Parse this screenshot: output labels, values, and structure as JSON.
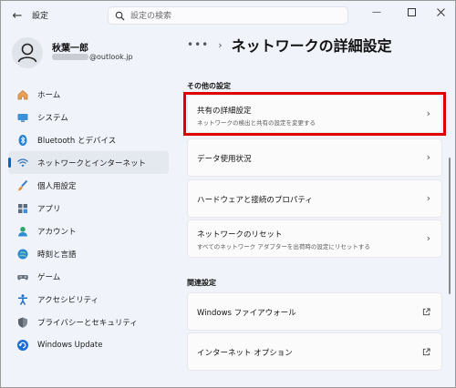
{
  "app": {
    "title": "設定"
  },
  "search": {
    "placeholder": "設定の検索"
  },
  "profile": {
    "name": "秋葉一郎",
    "email_suffix": "@outlook.jp"
  },
  "sidebar": {
    "items": [
      {
        "label": "ホーム",
        "icon": "home-icon"
      },
      {
        "label": "システム",
        "icon": "system-icon"
      },
      {
        "label": "Bluetooth とデバイス",
        "icon": "bluetooth-icon"
      },
      {
        "label": "ネットワークとインターネット",
        "icon": "network-wifi-icon",
        "active": true
      },
      {
        "label": "個人用設定",
        "icon": "brush-icon"
      },
      {
        "label": "アプリ",
        "icon": "apps-icon"
      },
      {
        "label": "アカウント",
        "icon": "account-icon"
      },
      {
        "label": "時刻と言語",
        "icon": "time-language-icon"
      },
      {
        "label": "ゲーム",
        "icon": "gamepad-icon"
      },
      {
        "label": "アクセシビリティ",
        "icon": "accessibility-icon"
      },
      {
        "label": "プライバシーとセキュリティ",
        "icon": "shield-icon"
      },
      {
        "label": "Windows Update",
        "icon": "windows-update-icon"
      }
    ]
  },
  "breadcrumb": {
    "dots": "•••",
    "separator": "›",
    "title": "ネットワークの詳細設定"
  },
  "sections": {
    "other": {
      "heading": "その他の設定",
      "cards": [
        {
          "title": "共有の詳細設定",
          "subtitle": "ネットワークの検出と共有の設定を変更する"
        },
        {
          "title": "データ使用状況"
        },
        {
          "title": "ハードウェアと接続のプロパティ"
        },
        {
          "title": "ネットワークのリセット",
          "subtitle": "すべてのネットワーク アダプターを出荷時の設定にリセットする"
        }
      ]
    },
    "related": {
      "heading": "関連設定",
      "cards": [
        {
          "title": "Windows ファイアウォール"
        },
        {
          "title": "インターネット オプション"
        }
      ]
    }
  },
  "colors": {
    "accent": "#0067c0",
    "highlight": "#e00000"
  }
}
